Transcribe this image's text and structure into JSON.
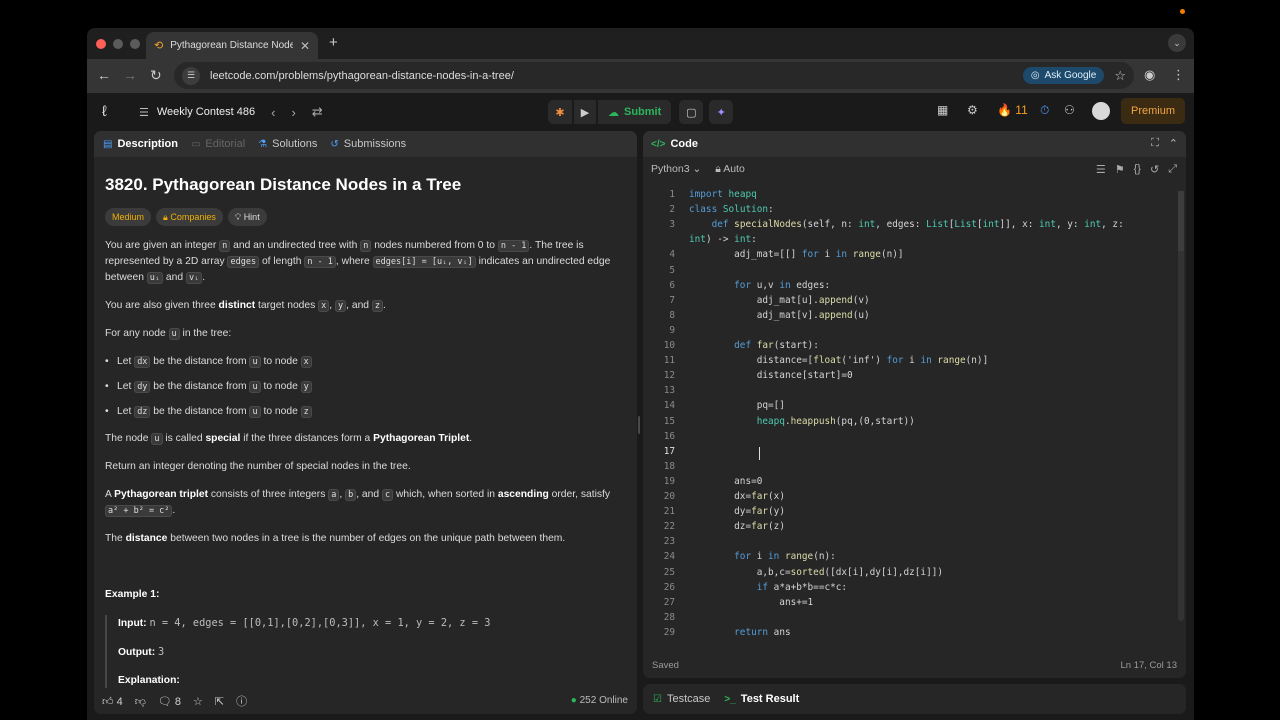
{
  "browser": {
    "tab_title": "Pythagorean Distance Nodes in a Tree",
    "url": "leetcode.com/problems/pythagorean-distance-nodes-in-a-tree/",
    "ask_google": "Ask Google"
  },
  "header": {
    "problem_list": "Weekly Contest 486",
    "submit_label": "Submit",
    "streak_count": "11",
    "premium_label": "Premium"
  },
  "left_tabs": {
    "description": "Description",
    "editorial": "Editorial",
    "solutions": "Solutions",
    "submissions": "Submissions"
  },
  "problem": {
    "title": "3820. Pythagorean Distance Nodes in a Tree",
    "difficulty": "Medium",
    "companies": "Companies",
    "hint": "Hint",
    "p1": {
      "a": "You are given an integer ",
      "n": "n",
      "b": " and an undirected tree with ",
      "c": " nodes numbered from 0 to ",
      "nm1": "n - 1",
      "d": ". The tree is represented by a 2D array ",
      "edges": "edges",
      "e": " of length ",
      "f": ", where ",
      "edgei": "edges[i] = [uᵢ, vᵢ]",
      "g": " indicates an undirected edge between ",
      "ui": "uᵢ",
      "h": " and ",
      "vi": "vᵢ",
      "i": "."
    },
    "p2": {
      "a": "You are also given three ",
      "distinct": "distinct",
      "b": " target nodes ",
      "x": "x",
      "c": ", ",
      "y": "y",
      "d": ", and ",
      "z": "z",
      "e": "."
    },
    "p3": {
      "a": "For any node ",
      "u": "u",
      "b": " in the tree:"
    },
    "bullets": [
      {
        "a": "Let ",
        "var": "dx",
        "b": " be the distance from ",
        "u": "u",
        "c": " to node ",
        "t": "x"
      },
      {
        "a": "Let ",
        "var": "dy",
        "b": " be the distance from ",
        "u": "u",
        "c": " to node ",
        "t": "y"
      },
      {
        "a": "Let ",
        "var": "dz",
        "b": " be the distance from ",
        "u": "u",
        "c": " to node ",
        "t": "z"
      }
    ],
    "p4": {
      "a": "The node ",
      "u": "u",
      "b": " is called ",
      "special": "special",
      "c": " if the three distances form a ",
      "triplet": "Pythagorean Triplet",
      "d": "."
    },
    "p5": "Return an integer denoting the number of special nodes in the tree.",
    "p6": {
      "a": "A ",
      "triplet": "Pythagorean triplet",
      "b": " consists of three integers ",
      "a_": "a",
      "c": ", ",
      "b_": "b",
      "d": ", and ",
      "c_": "c",
      "e": " which, when sorted in ",
      "asc": "ascending",
      "f": " order, satisfy ",
      "formula": "a² + b² = c²",
      "g": "."
    },
    "p7": {
      "a": "The ",
      "distance": "distance",
      "b": " between two nodes in a tree is the number of edges on the unique path between them."
    },
    "example_title": "Example 1:",
    "ex_input_label": "Input:",
    "ex_input": "n = 4, edges = [[0,1],[0,2],[0,3]], x = 1, y = 2, z = 3",
    "ex_output_label": "Output:",
    "ex_output": "3",
    "ex_expl_label": "Explanation:"
  },
  "left_footer": {
    "likes": "4",
    "comments": "8",
    "online_count": "252 Online"
  },
  "code_panel": {
    "title": "Code",
    "language": "Python3",
    "mode": "Auto",
    "status_saved": "Saved",
    "cursor_pos": "Ln 17, Col 13",
    "current_line": 17,
    "lines": [
      "import heapq",
      "class Solution:",
      "    def specialNodes(self, n: int, edges: List[List[int]], x: int, y: int, z:",
      "int) -> int:",
      "        adj_mat=[[] for i in range(n)]",
      "",
      "        for u,v in edges:",
      "            adj_mat[u].append(v)",
      "            adj_mat[v].append(u)",
      "",
      "        def far(start):",
      "            distance=[float('inf') for i in range(n)]",
      "            distance[start]=0",
      "",
      "            pq=[]",
      "            heapq.heappush(pq,(0,start))",
      "",
      "",
      "",
      "        ans=0",
      "        dx=far(x)",
      "        dy=far(y)",
      "        dz=far(z)",
      "",
      "        for i in range(n):",
      "            a,b,c=sorted([dx[i],dy[i],dz[i]])",
      "            if a*a+b*b==c*c:",
      "                ans+=1",
      "",
      "        return ans"
    ],
    "line_numbers": [
      "1",
      "2",
      "3",
      "",
      "4",
      "5",
      "6",
      "7",
      "8",
      "9",
      "10",
      "11",
      "12",
      "13",
      "14",
      "15",
      "16",
      "17",
      "18",
      "19",
      "20",
      "21",
      "22",
      "23",
      "24",
      "25",
      "26",
      "27",
      "28",
      "29"
    ]
  },
  "bottom_tabs": {
    "testcase": "Testcase",
    "test_result": "Test Result"
  }
}
